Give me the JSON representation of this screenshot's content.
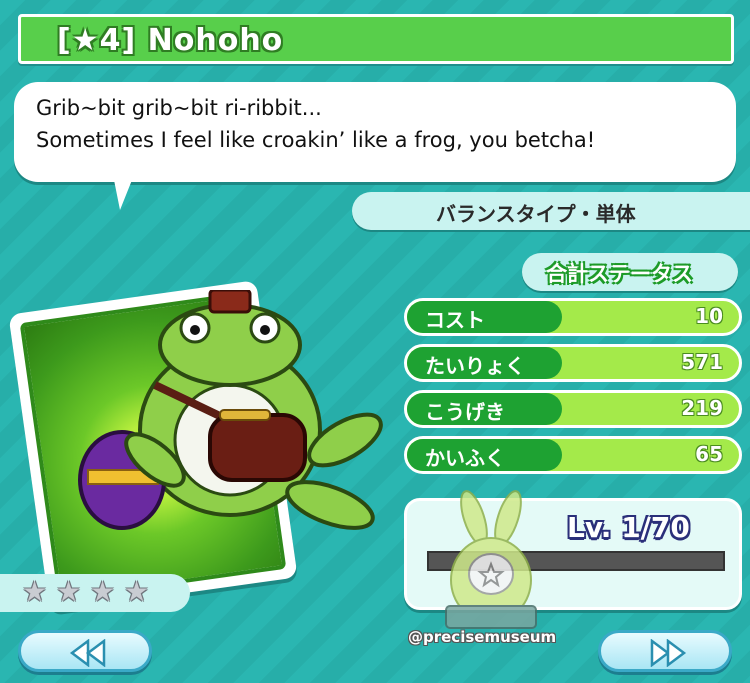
{
  "title": "[★4] Nohoho",
  "speech": {
    "line1": "Grib~bit grib~bit ri-ribbit...",
    "line2": "Sometimes I feel like croakin’ like a frog, you betcha!"
  },
  "type_label": "バランスタイプ・単体",
  "stats": {
    "header": "合計ステータス",
    "rows": [
      {
        "label": "コスト",
        "value": "10"
      },
      {
        "label": "たいりょく",
        "value": "571"
      },
      {
        "label": "こうげき",
        "value": "219"
      },
      {
        "label": "かいふく",
        "value": "65"
      }
    ]
  },
  "level": {
    "text": "Lv. 1/70",
    "exp_fraction": 0
  },
  "rarity": {
    "stars": 4,
    "star_icon": "star-icon"
  },
  "watermark": "@precisemuseum",
  "nav": {
    "prev_icon": "rewind-icon",
    "next_icon": "fast-forward-icon"
  },
  "colors": {
    "background": "#2ab5b0",
    "title_bar": "#58cf4b",
    "stat_label": "#1ea232",
    "stat_bar": "#a4ea4a",
    "level_text_outline": "#2a2f7a"
  }
}
